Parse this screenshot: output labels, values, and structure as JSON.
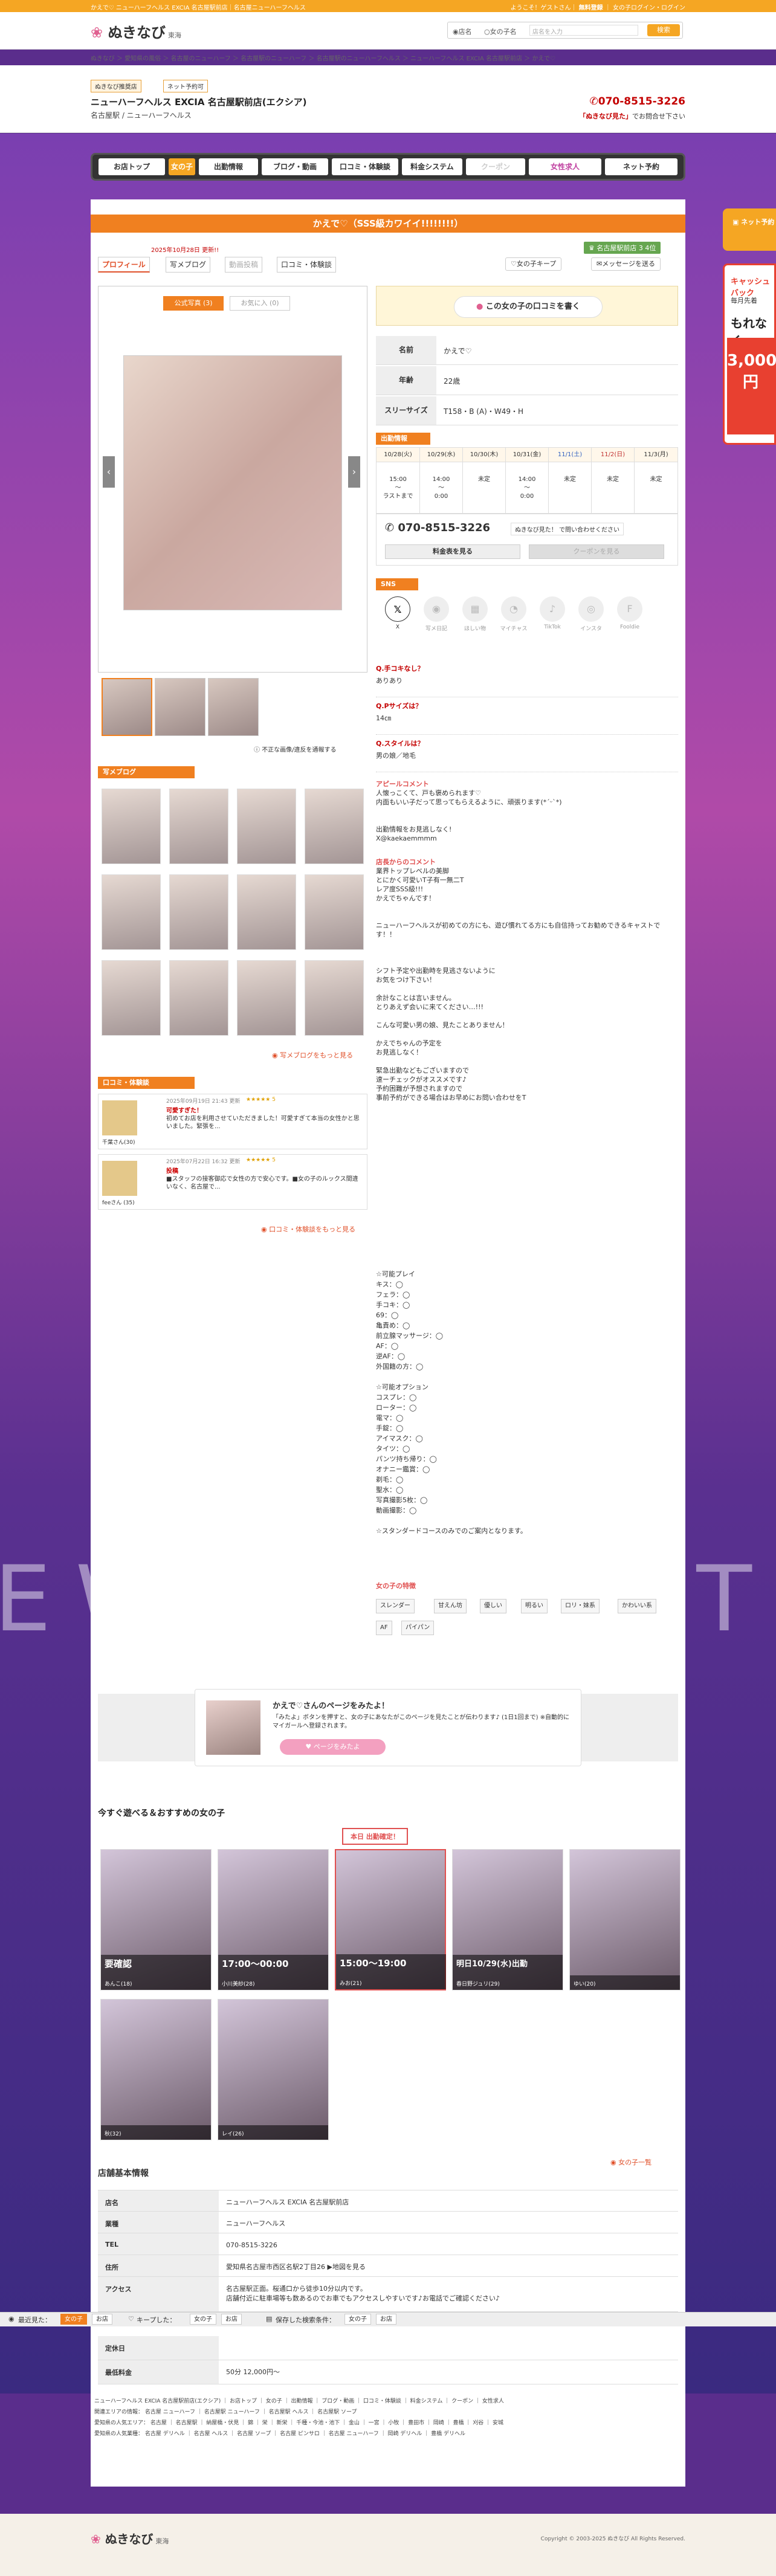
{
  "topline": {
    "left": "かえで♡ ニューハーフヘルス EXCIA 名古屋駅前店｜名古屋ニューハーフヘルス",
    "right": "ようこそ！ゲストさん｜",
    "register": "無料登録",
    "favorite": "女の子ログイン・ログイン"
  },
  "header": {
    "logo": "ぬきなび",
    "logo_sub": "東海",
    "search_opt1": "店名",
    "search_opt2": "女の子名",
    "search_placeholder": "店名を入力",
    "search_button": "検索"
  },
  "breadcrumb": "ぬきなび ＞ 愛知県の風俗 ＞ 名古屋のニューハーフ ＞ 名古屋駅のニューハーフ ＞ 名古屋駅のニューハーフヘルス ＞ ニューハーフヘルス EXCIA 名古屋駅前店 ＞ かえで♡",
  "shop": {
    "badge1": "ぬきなび推奨店",
    "badge2": "ネット予約可",
    "name": "ニューハーフヘルス EXCIA 名古屋駅前店(エクシア)",
    "sub": "名古屋駅 / ニューハーフヘルス",
    "tel": "070-8515-3226",
    "note_pre": "「ぬきなび見た」",
    "note": "でお問合せ下さい"
  },
  "nav": [
    "お店トップ",
    "女の子",
    "出勤情報",
    "ブログ・動画",
    "口コミ・体験談",
    "料金システム",
    "クーポン",
    "女性求人",
    "ネット予約"
  ],
  "profile": {
    "title": "かえで♡（SSS級カワイイ!!!!!!!!）",
    "date": "2025年10月28日 更新!!",
    "tabs": [
      "プロフィール",
      "写メブログ",
      "動画投稿",
      "口コミ・体験談"
    ],
    "attend_badge": "名古屋駅前店 3 4位",
    "keep_btn": "女の子キープ",
    "msg_btn": "メッセージを送る",
    "photo_tab1": "公式写真 (3)",
    "photo_tab2": "お気に入 (0)",
    "report": "不正な画像/違反を通報する",
    "review_btn": "この女の子の口コミを書く",
    "info": [
      {
        "k": "名前",
        "v": "かえで♡"
      },
      {
        "k": "年齢",
        "v": "22歳"
      },
      {
        "k": "スリーサイズ",
        "v": "T158・B (A)・W49・H"
      }
    ],
    "schedule_title": "出勤情報",
    "schedule": [
      {
        "d": "10/28(火)",
        "t": "15:00\n〜\nラストまで"
      },
      {
        "d": "10/29(水)",
        "t": "14:00\n〜\n0:00"
      },
      {
        "d": "10/30(木)",
        "t": "未定"
      },
      {
        "d": "10/31(金)",
        "t": "14:00\n〜\n0:00"
      },
      {
        "d": "11/1(土)",
        "t": "未定"
      },
      {
        "d": "11/2(日)",
        "t": "未定"
      },
      {
        "d": "11/3(月)",
        "t": "未定"
      }
    ],
    "tel": "070-8515-3226",
    "tel_note": "ぬきなび見た！ で問い合わせください",
    "price_btn": "料金表を見る",
    "coupon_btn": "クーポンを見る",
    "sns_title": "SNS",
    "sns": [
      "X",
      "写メ日記",
      "ほしい物",
      "マイチャス",
      "TikTok",
      "インスタ",
      "Fooldie"
    ],
    "qa": [
      {
        "q": "Q.手コキなし？",
        "a": "ありあり"
      },
      {
        "q": "Q.Pサイズは？",
        "a": "14㎝"
      },
      {
        "q": "Q.スタイルは？",
        "a": "男の娘／地毛"
      }
    ],
    "appeal_h": "アピールコメント",
    "appeal": "人懐っこくて、戸も褒められます♡\n内面もいい子だって思ってもらえるように、頑張ります(*ˊᵕˋ*)\n\n\n出勤情報をお見逃しなく!\nX@kaekaemmmm",
    "shop_comment_h": "店長からのコメント",
    "shop_comment": "業界トップレベルの美脚\nとにかく可愛いT子有一無二T\nレア度SSS級!!!\nかえでちゃんです！\n\n\nニューハーフヘルスが初めての方にも、遊び慣れてる方にも自信持ってお勧めできるキャストです！！\n\n\n\nシフト予定や出勤時を見逃さないように\nお気をつけ下さい！\n\n余計なことは言いません。\nとりあえず会いに来てください…!!!\n\nこんな可愛い男の娘、見たことありません！\n\nかえでちゃんの予定を\nお見逃しなく！\n\n緊急出勤などもございますので\n速ーチェックがオススメです♪\n予約困難が予想されますので\n事前予約ができる場合はお早めにお問い合わせをT",
    "play_h": "☆可能プレイ",
    "play": "キス：◯\nフェラ：◯\n手コキ：◯\n69：◯\n亀責め：◯\n前立腺マッサージ：◯\nAF：◯\n逆AF：◯\n外国籍の方：◯\n\n☆可能オプション\nコスプレ：◯\nローター：◯\n電マ：◯\n手錠：◯\nアイマスク：◯\nタイツ：◯\nパンツ持ち帰り：◯\nオナニー鑑賞：◯\n剃毛：◯\n聖水：◯\n写真撮影5枚：◯\n動画撮影：◯\n\n☆スタンダードコースのみでのご案内となります。",
    "features_h": "女の子の特徴",
    "features": [
      "スレンダー",
      "甘えん坊",
      "優しい",
      "明るい",
      "ロリ・妹系",
      "かわいい系",
      "AF",
      "パイパン"
    ]
  },
  "blog": {
    "title": "写メブログ",
    "more": "写メブログをもっと見る"
  },
  "reviews": {
    "title": "口コミ・体験談",
    "items": [
      {
        "name": "千葉さん(30)",
        "date": "2025年09月19日 21:43 更新",
        "stars": "★★★★★ 5",
        "title": "可愛すぎた！",
        "text": "初めてお店を利用させていただきました！可愛すぎて本当の女性かと思いました。緊張を..."
      },
      {
        "name": "feeさん (35)",
        "date": "2025年07月22日 16:32 更新",
        "stars": "★★★★★ 5",
        "title": "投稿",
        "text": "■スタッフの接客御応で女性の方で安心です。■女の子のルックス間違いなく、名古屋で..."
      }
    ],
    "more": "口コミ・体験談をもっと見る"
  },
  "follow": {
    "title": "かえで♡さんのページをみたよ！",
    "desc": "「みたよ」ボタンを押すと、女の子にあなたがこのページを見たことが伝わります♪ (1日1回まで) ※自動的にマイガールへ登録されます。",
    "button": "ページをみたよ"
  },
  "recommend": {
    "title": "今すぐ遊べる＆おすすめの女の子",
    "flag": "本日 出勤確定！",
    "cards": [
      {
        "time": "要確認",
        "name": "あんこ(18)"
      },
      {
        "time": "17:00〜00:00",
        "name": "小川美紗(28)"
      },
      {
        "time": "15:00〜19:00",
        "name": "みお(21)"
      },
      {
        "time": "明日10/29(水)出勤",
        "name": "春日野ジュリ(29)"
      },
      {
        "time": "",
        "name": "ゆい(20)"
      },
      {
        "time": "",
        "name": "秋(32)"
      },
      {
        "time": "",
        "name": "レイ(26)"
      }
    ],
    "more": "女の子一覧"
  },
  "basic": {
    "title": "店舗基本情報",
    "rows": [
      {
        "k": "店名",
        "v": "ニューハーフヘルス EXCIA 名古屋駅前店"
      },
      {
        "k": "業種",
        "v": "ニューハーフヘルス"
      },
      {
        "k": "TEL",
        "v": "070-8515-3226"
      },
      {
        "k": "住所",
        "v": "愛知県名古屋市西区名駅2丁目26 ▶地図を見る"
      },
      {
        "k": "アクセス",
        "v": "名古屋駅正面。桜通口から徒歩10分以内です。\n店舗付近に駐車場等も数あるのでお車でもアクセスしやすいです♪お電話でご確認ください♪"
      },
      {
        "k": "定休日",
        "v": ""
      },
      {
        "k": "最低料金",
        "v": "50分 12,000円〜"
      }
    ]
  },
  "recentbar": {
    "label1": "最近見た：",
    "pill1": "女の子",
    "pill2": "お店",
    "label2": "キープした：",
    "pill3": "女の子",
    "pill4": "お店",
    "label3": "保存した検索条件：",
    "pill5": "女の子",
    "pill6": "お店"
  },
  "footer": {
    "line1": "ニューハーフヘルス EXCIA 名古屋駅前店(エクシア) ｜ お店トップ ｜ 女の子 ｜ 出勤情報 ｜ ブログ・動画 ｜ 口コミ・体験談 ｜ 料金システム ｜ クーポン ｜ 女性求人",
    "line2": "関連エリアの情報： 名古屋 ニューハーフ ｜ 名古屋駅 ニューハーフ ｜ 名古屋駅 ヘルス ｜ 名古屋駅 ソープ",
    "line3": "愛知県の人気エリア： 名古屋 ｜ 名古屋駅 ｜ 納屋橋・伏見 ｜ 錦 ｜ 栄 ｜ 新栄 ｜ 千種・今池・池下 ｜ 金山 ｜ 一宮 ｜ 小牧 ｜ 豊田市 ｜ 岡崎 ｜ 豊橋 ｜ 刈谷 ｜ 安城",
    "line4": "愛知県の人気業種： 名古屋 デリヘル ｜ 名古屋 ヘルス ｜ 名古屋 ソープ ｜ 名古屋 ピンサロ ｜ 名古屋 ニューハーフ ｜ 岡崎 デリヘル ｜ 豊橋 デリヘル",
    "logo": "ぬきなび",
    "logo_sub": "東海",
    "copyright": "Copyright © 2003-2025 ぬきなび All Rights Reserved."
  },
  "side": {
    "badge": "ネット予約",
    "adv_a": "キャッシュバック",
    "adv_b": "毎月先着",
    "adv_c": "もれなく",
    "adv_d": "3,000\n円"
  },
  "bigtext": "EW",
  "bigtext2": "LT"
}
